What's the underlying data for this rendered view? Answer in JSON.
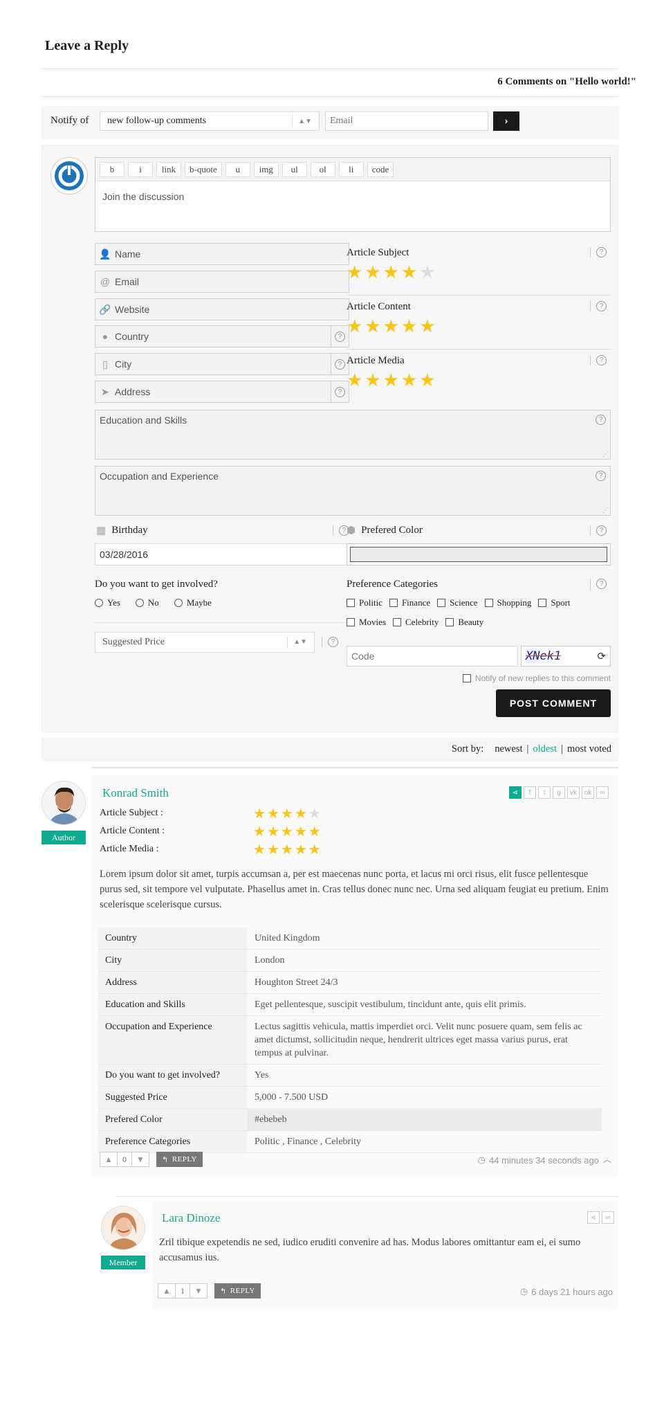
{
  "reply_title": "Leave a Reply",
  "comments_count": "6 Comments on \"Hello world!\"",
  "notify": {
    "label": "Notify of",
    "selected": "new follow-up comments",
    "email_placeholder": "Email",
    "submit": "›"
  },
  "editor": {
    "buttons": [
      "b",
      "i",
      "link",
      "b-quote",
      "u",
      "img",
      "ul",
      "ol",
      "li",
      "code"
    ],
    "placeholder": "Join the discussion"
  },
  "fields": {
    "name": "Name",
    "email": "Email",
    "website": "Website",
    "country": "Country",
    "city": "City",
    "address": "Address",
    "education": "Education and Skills",
    "occupation": "Occupation and Experience",
    "birthday_label": "Birthday",
    "birthday_value": "03/28/2016",
    "color_label": "Prefered Color",
    "involved_label": "Do you want to get involved?",
    "involved_options": [
      "Yes",
      "No",
      "Maybe"
    ],
    "categories_label": "Preference Categories",
    "categories": [
      "Politic",
      "Finance",
      "Science",
      "Shopping",
      "Sport",
      "Movies",
      "Celebrity",
      "Beauty"
    ],
    "price_placeholder": "Suggested Price",
    "code_placeholder": "Code",
    "captcha": "XNek1",
    "notify_replies": "Notify of new replies to this comment",
    "post": "POST COMMENT"
  },
  "form_ratings": [
    {
      "label": "Article Subject",
      "value": 4,
      "max": 5
    },
    {
      "label": "Article Content",
      "value": 5,
      "max": 5
    },
    {
      "label": "Article Media",
      "value": 5,
      "max": 5
    }
  ],
  "sort": {
    "label": "Sort by:",
    "newest": "newest",
    "oldest": "oldest",
    "most_voted": "most voted",
    "sep": "|",
    "active_color": "#10ab8e"
  },
  "comment1": {
    "author": "Konrad Smith",
    "badge": "Author",
    "ratings": [
      {
        "label": "Article Subject :",
        "value": 4,
        "max": 5
      },
      {
        "label": "Article Content :",
        "value": 5,
        "max": 5
      },
      {
        "label": "Article Media :",
        "value": 5,
        "max": 5
      }
    ],
    "text": "Lorem ipsum dolor sit amet, turpis accumsan a, per est maecenas nunc porta, et lacus mi orci risus, elit fusce pellentesque purus sed, sit tempore vel vulputate. Phasellus amet in. Cras tellus donec nunc nec. Urna sed aliquam feugiat eu pretium. Enim scelerisque scelerisque cursus.",
    "info": [
      {
        "k": "Country",
        "v": "United Kingdom"
      },
      {
        "k": "City",
        "v": "London"
      },
      {
        "k": "Address",
        "v": "Houghton Street 24/3"
      },
      {
        "k": "Education and Skills",
        "v": "Eget pellentesque, suscipit vestibulum, tincidunt ante, quis elit primis."
      },
      {
        "k": "Occupation and Experience",
        "v": "Lectus sagittis vehicula, mattis imperdiet orci. Velit nunc posuere quam, sem felis ac amet dictumst, sollicitudin neque, hendrerit ultrices eget massa varius purus, erat tempus at pulvinar."
      },
      {
        "k": "Do you want to get involved?",
        "v": "Yes"
      },
      {
        "k": "Suggested Price",
        "v": "5,000 - 7.500 USD"
      },
      {
        "k": "Prefered Color",
        "v": "#ebebeb"
      },
      {
        "k": "Preference Categories",
        "v": "Politic , Finance , Celebrity"
      }
    ],
    "votes": "0",
    "reply": "REPLY",
    "time": "44 minutes 34 seconds ago"
  },
  "comment2": {
    "author": "Lara Dinoze",
    "badge": "Member",
    "text": "Zril tibique expetendis ne sed, iudico eruditi convenire ad has. Modus labores omittantur eam ei, ei sumo accusamus ius.",
    "votes": "1",
    "reply": "REPLY",
    "time": "6 days 21 hours ago"
  },
  "colors": {
    "accent": "#10ab8e",
    "star": "#f5c518",
    "dark_button": "#1a1a1a"
  }
}
